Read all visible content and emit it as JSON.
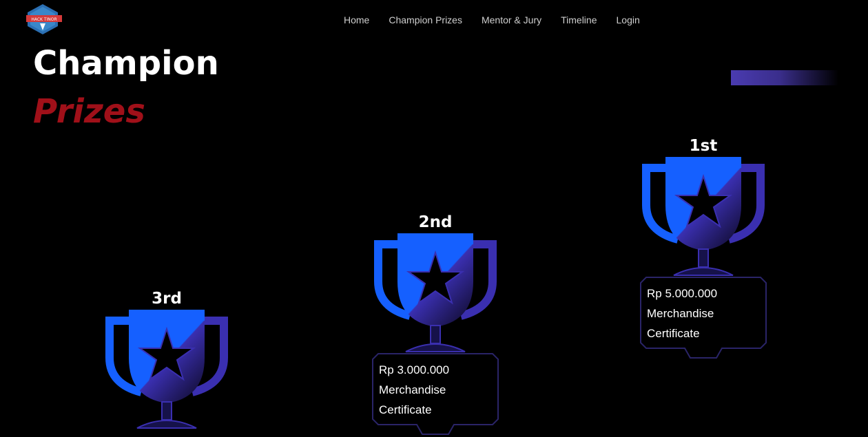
{
  "brand": {
    "logo_text": "HACK TINOR"
  },
  "nav": {
    "items": [
      "Home",
      "Champion Prizes",
      "Mentor & Jury",
      "Timeline",
      "Login"
    ]
  },
  "hero": {
    "title_line1": "Champion",
    "title_line2": "Prizes"
  },
  "colors": {
    "accent_red": "#a01019",
    "trophy_blue": "#1560ff",
    "trophy_purple": "#3a2fb0"
  },
  "podium": [
    {
      "rank": "3rd",
      "prize": "",
      "extra1": "",
      "extra2": ""
    },
    {
      "rank": "2nd",
      "prize": "Rp 3.000.000",
      "extra1": "Merchandise",
      "extra2": "Certificate"
    },
    {
      "rank": "1st",
      "prize": "Rp 5.000.000",
      "extra1": "Merchandise",
      "extra2": "Certificate"
    }
  ]
}
